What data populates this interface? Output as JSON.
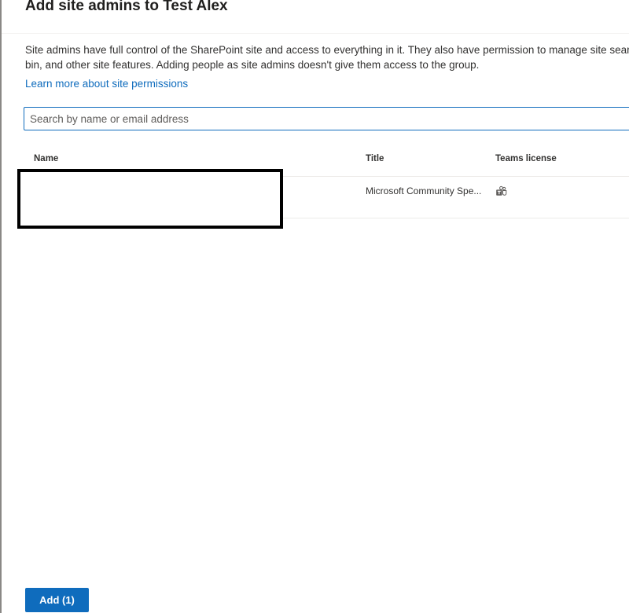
{
  "panel": {
    "title": "Add site admins to Test Alex",
    "description": "Site admins have full control of the SharePoint site and access to everything in it. They also have permission to manage site searc\nbin, and other site features. Adding people as site admins doesn't give them access to the group.",
    "learn_more_link": "Learn more about site permissions"
  },
  "search": {
    "placeholder": "Search by name or email address",
    "value": ""
  },
  "table": {
    "columns": {
      "name": "Name",
      "title": "Title",
      "teams_license": "Teams license"
    },
    "rows": [
      {
        "name": "",
        "title": "Microsoft Community Spe...",
        "teams_license_icon": "teams-icon"
      }
    ]
  },
  "footer": {
    "add_button": "Add (1)"
  },
  "colors": {
    "accent": "#0f6cbd",
    "text": "#323130"
  }
}
